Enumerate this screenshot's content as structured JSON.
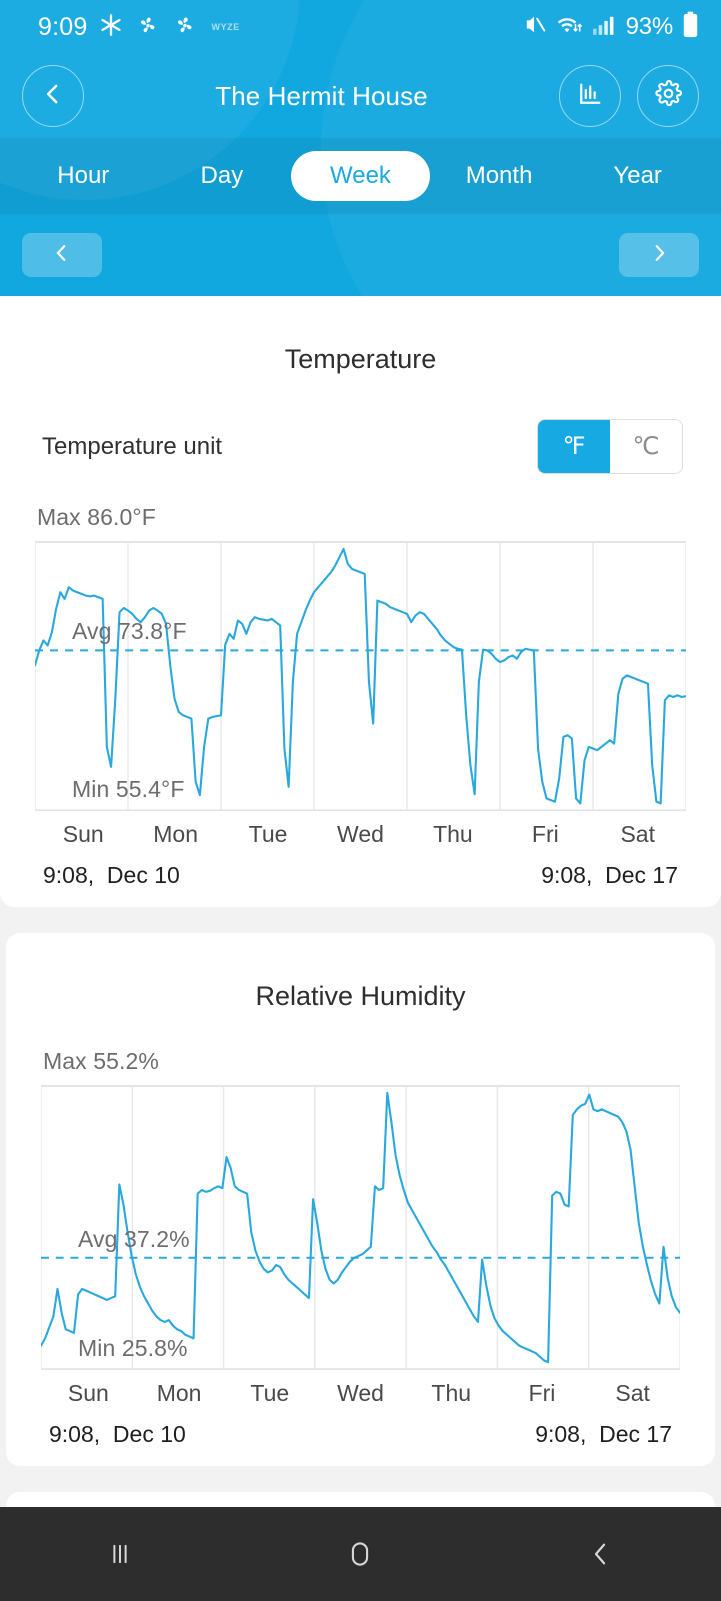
{
  "statusbar": {
    "time": "9:09",
    "icons": [
      "snowflake-icon",
      "fan-icon",
      "fan-icon"
    ],
    "brand_mark": "WYZE",
    "mute_icon": "mute-icon",
    "wifi_icon": "wifi-transfer-icon",
    "signal_icon": "cellular-signal-icon",
    "battery_percent": "93%"
  },
  "header": {
    "back_icon": "chevron-left-icon",
    "title": "The Hermit House",
    "chart_icon": "bar-chart-icon",
    "settings_icon": "gear-icon"
  },
  "tabs": [
    {
      "label": "Hour",
      "active": false
    },
    {
      "label": "Day",
      "active": false
    },
    {
      "label": "Week",
      "active": true
    },
    {
      "label": "Month",
      "active": false
    },
    {
      "label": "Year",
      "active": false
    }
  ],
  "range_nav": {
    "prev_icon": "chevron-left-icon",
    "next_icon": "chevron-right-icon"
  },
  "temperature": {
    "title": "Temperature",
    "unit_label": "Temperature unit",
    "unit_options": [
      {
        "label": "℉",
        "selected": true
      },
      {
        "label": "℃",
        "selected": false
      }
    ],
    "max_label": "Max 86.0°F",
    "avg_label": "Avg 73.8°F",
    "min_label": "Min 55.4°F",
    "start_time": "9:08,  Dec 10",
    "end_time": "9:08,  Dec 17"
  },
  "humidity": {
    "title": "Relative Humidity",
    "max_label": "Max 55.2%",
    "avg_label": "Avg 37.2%",
    "min_label": "Min 25.8%",
    "start_time": "9:08,  Dec 10",
    "end_time": "9:08,  Dec 17"
  },
  "day_axis": [
    "Sun",
    "Mon",
    "Tue",
    "Wed",
    "Thu",
    "Fri",
    "Sat"
  ],
  "colors": {
    "brand_blue": "#11a8e0",
    "line_blue": "#29a8dd",
    "card_white": "#ffffff",
    "page_gray": "#f2f2f2",
    "nav_dark": "#2d2d2d"
  },
  "navbar": {
    "recents_icon": "recents-icon",
    "home_icon": "home-icon",
    "back_icon": "back-icon"
  },
  "chart_data": [
    {
      "type": "line",
      "title": "Temperature",
      "xlabel": "",
      "ylabel": "°F",
      "unit": "°F",
      "ylim": [
        55.4,
        86.0
      ],
      "max": 86.0,
      "avg": 73.8,
      "min": 55.4,
      "grid": true,
      "legend": "none",
      "categories": [
        "Sun",
        "Mon",
        "Tue",
        "Wed",
        "Thu",
        "Fri",
        "Sat"
      ],
      "x_start": "9:08,  Dec 10",
      "x_end": "9:08,  Dec 17",
      "avg_line": 73.8,
      "values": [
        72.0,
        73.8,
        75.0,
        74.4,
        76.0,
        78.8,
        80.8,
        80.0,
        81.4,
        81.0,
        80.8,
        80.6,
        80.4,
        80.3,
        80.4,
        80.2,
        80.0,
        62.2,
        59.8,
        68.0,
        78.4,
        78.9,
        78.6,
        78.2,
        77.6,
        77.2,
        77.8,
        78.6,
        78.9,
        78.6,
        78.2,
        77.0,
        72.0,
        68.0,
        66.4,
        66.0,
        65.8,
        65.6,
        58.0,
        56.4,
        62.2,
        65.6,
        65.8,
        65.9,
        66.0,
        74.5,
        75.8,
        75.2,
        77.4,
        77.0,
        75.8,
        77.2,
        77.8,
        77.6,
        77.5,
        77.4,
        77.6,
        77.2,
        76.8,
        62.0,
        57.4,
        70.0,
        75.8,
        77.2,
        78.6,
        79.8,
        80.8,
        81.4,
        82.0,
        82.6,
        83.2,
        84.0,
        85.0,
        86.0,
        84.2,
        83.6,
        83.4,
        83.2,
        83.0,
        70.0,
        65.0,
        79.8,
        79.6,
        79.4,
        79.0,
        78.8,
        78.6,
        78.4,
        78.2,
        77.2,
        78.0,
        78.4,
        78.2,
        77.6,
        77.0,
        76.4,
        75.6,
        75.0,
        74.6,
        74.2,
        74.0,
        73.9,
        66.0,
        60.0,
        56.5,
        70.0,
        73.9,
        73.8,
        73.4,
        72.8,
        72.4,
        72.6,
        73.0,
        73.2,
        72.8,
        73.6,
        74.0,
        73.9,
        73.8,
        62.0,
        58.0,
        56.0,
        55.8,
        55.6,
        58.4,
        63.4,
        63.6,
        63.2,
        56.0,
        55.4,
        60.6,
        62.2,
        62.0,
        61.8,
        62.2,
        62.6,
        63.0,
        62.6,
        68.6,
        70.4,
        70.8,
        70.6,
        70.4,
        70.2,
        70.0,
        69.8,
        60.0,
        55.6,
        55.4,
        67.8,
        68.4,
        68.2,
        68.4,
        68.2,
        68.3
      ]
    },
    {
      "type": "line",
      "title": "Relative Humidity",
      "xlabel": "",
      "ylabel": "%",
      "unit": "%",
      "ylim": [
        25.8,
        55.2
      ],
      "max": 55.2,
      "avg": 37.2,
      "min": 25.8,
      "grid": true,
      "legend": "none",
      "categories": [
        "Sun",
        "Mon",
        "Tue",
        "Wed",
        "Thu",
        "Fri",
        "Sat"
      ],
      "x_start": "9:08,  Dec 10",
      "x_end": "9:08,  Dec 17",
      "avg_line": 37.2,
      "values": [
        27.6,
        28.4,
        29.6,
        30.8,
        33.8,
        31.2,
        29.4,
        29.2,
        29.0,
        33.2,
        33.8,
        33.6,
        33.4,
        33.2,
        33.0,
        32.8,
        32.6,
        32.8,
        33.0,
        45.2,
        43.0,
        40.0,
        37.4,
        35.4,
        34.0,
        33.0,
        32.2,
        31.4,
        30.8,
        30.4,
        30.2,
        30.4,
        29.8,
        29.4,
        29.2,
        28.8,
        28.6,
        28.4,
        44.2,
        44.6,
        44.4,
        44.5,
        44.8,
        45.0,
        44.8,
        48.2,
        47.0,
        45.0,
        44.6,
        44.4,
        44.2,
        40.0,
        38.0,
        36.8,
        36.0,
        35.6,
        35.8,
        36.4,
        36.2,
        35.4,
        34.8,
        34.4,
        34.0,
        33.6,
        33.2,
        32.8,
        43.6,
        41.0,
        38.0,
        36.0,
        34.8,
        34.4,
        34.8,
        35.6,
        36.2,
        36.8,
        37.2,
        37.4,
        37.6,
        38.0,
        38.4,
        45.0,
        44.6,
        44.8,
        55.2,
        52.0,
        48.4,
        46.2,
        44.6,
        43.2,
        42.4,
        41.6,
        40.8,
        40.0,
        39.2,
        38.4,
        37.8,
        37.0,
        36.4,
        35.6,
        34.8,
        34.0,
        33.2,
        32.4,
        31.6,
        30.8,
        30.2,
        37.0,
        34.2,
        32.0,
        30.6,
        29.8,
        29.2,
        28.8,
        28.4,
        28.0,
        27.6,
        27.4,
        27.2,
        27.0,
        26.8,
        26.4,
        26.0,
        25.8,
        44.0,
        44.4,
        44.2,
        43.0,
        42.8,
        52.8,
        53.4,
        53.8,
        54.0,
        55.0,
        53.4,
        53.2,
        53.4,
        53.2,
        53.0,
        52.8,
        52.6,
        52.0,
        51.0,
        49.0,
        45.0,
        41.0,
        38.4,
        36.4,
        34.6,
        33.2,
        32.2,
        38.4,
        35.0,
        33.0,
        31.8,
        31.2
      ]
    }
  ]
}
